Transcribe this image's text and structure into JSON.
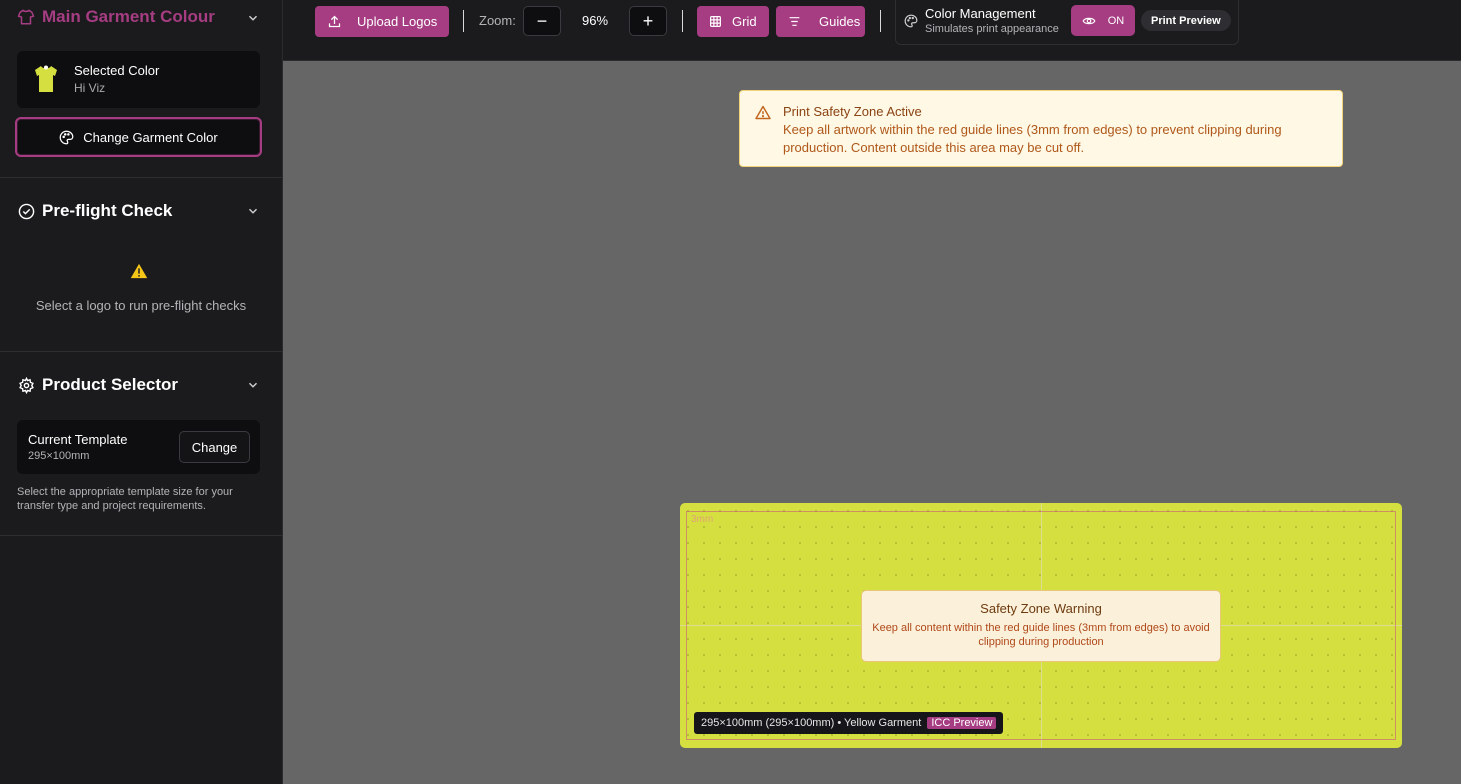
{
  "sidebar": {
    "garment": {
      "title": "Main Garment Colour",
      "selected_label": "Selected Color",
      "selected_value": "Hi Viz",
      "change_button": "Change Garment Color",
      "swatch_color": "#d5e040"
    },
    "preflight": {
      "title": "Pre-flight Check",
      "message": "Select a logo to run pre-flight checks"
    },
    "product": {
      "title": "Product Selector",
      "current_label": "Current Template",
      "current_value": "295×100mm",
      "change_button": "Change",
      "help": "Select the appropriate template size for your transfer type and project requirements."
    }
  },
  "toolbar": {
    "upload_label": "Upload Logos",
    "zoom_label": "Zoom:",
    "zoom_minus": "−",
    "zoom_value": "96%",
    "zoom_plus": "+",
    "grid_label": "Grid",
    "guides_label": "Guides",
    "color_mgmt_title": "Color Management",
    "color_mgmt_subtitle": "Simulates print appearance",
    "toggle_label": "ON",
    "print_preview_label": "Print Preview"
  },
  "banner": {
    "title": "Print Safety Zone Active",
    "body": "Keep all artwork within the red guide lines (3mm from edges) to prevent clipping during production. Content outside this area may be cut off."
  },
  "canvas": {
    "margin_label": "3mm",
    "warning_title": "Safety Zone Warning",
    "warning_body": "Keep all content within the red guide lines (3mm from edges) to avoid clipping during production",
    "dimensions": "295×100mm (295×100mm) • Yellow Garment",
    "icc_badge": "ICC Preview"
  },
  "colors": {
    "accent": "#a63d82",
    "sidebar_bg": "#1b1b1d",
    "canvas_bg": "#666666",
    "garment": "#d5e040",
    "warning_bg": "#fef8e5"
  }
}
